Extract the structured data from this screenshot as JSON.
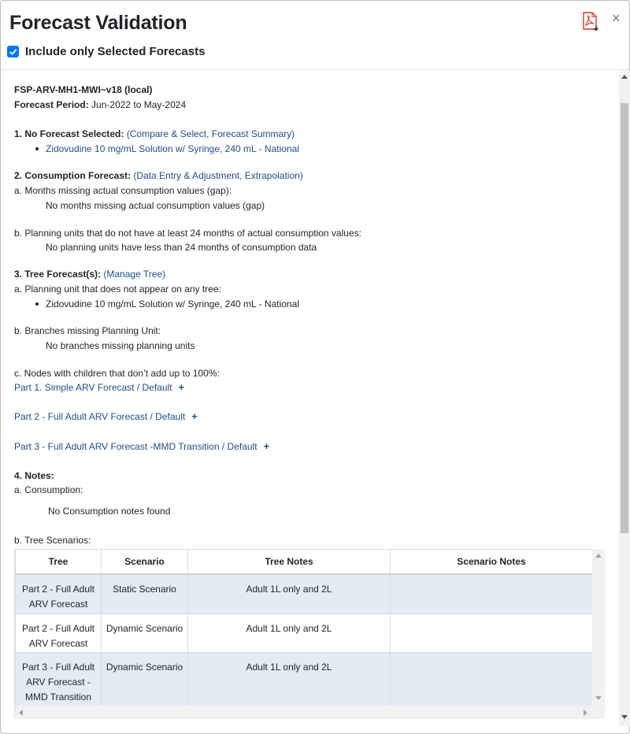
{
  "modal": {
    "title": "Forecast Validation",
    "include_label": "Include only Selected Forecasts",
    "include_checked": true,
    "icons": {
      "export": "pdf-export-icon",
      "close": "close-icon"
    },
    "close_glyph": "×"
  },
  "content": {
    "program": "FSP-ARV-MH1-MWI~v18 (local)",
    "period_label": "Forecast Period:",
    "period_value": "Jun-2022 to May-2024",
    "s1": {
      "heading": "1. No Forecast Selected:",
      "open": "(",
      "links": [
        "Compare & Select",
        "Forecast Summary"
      ],
      "sep": ", ",
      "close": ")",
      "items": [
        "Zidovudine 10 mg/mL Solution w/ Syringe, 240 mL - National"
      ]
    },
    "s2": {
      "heading": "2. Consumption Forecast:",
      "open": "(",
      "links": [
        "Data Entry & Adjustment",
        "Extrapolation"
      ],
      "sep": ", ",
      "close": ")",
      "a_label": "a. Months missing actual consumption values (gap):",
      "a_value": "No months missing actual consumption values (gap)",
      "b_label": "b. Planning units that do not have at least 24 months of actual consumption values:",
      "b_value": "No planning units have less than 24 months of consumption data"
    },
    "s3": {
      "heading": "3. Tree Forecast(s):",
      "open": "(",
      "link": "Manage Tree",
      "close": ")",
      "a_label": "a. Planning unit that does not appear on any tree:",
      "a_items": [
        "Zidovudine 10 mg/mL Solution w/ Syringe, 240 mL - National"
      ],
      "b_label": "b. Branches missing Planning Unit:",
      "b_value": "No branches missing planning units",
      "c_label": "c. Nodes with children that don’t add up to 100%:",
      "trees": [
        "Part 1. Simple ARV Forecast / Default",
        "Part 2 - Full Adult ARV Forecast / Default",
        "Part 3 - Full Adult ARV Forecast -MMD Transition / Default"
      ],
      "expand_glyph": "+"
    },
    "s4": {
      "heading": "4. Notes:",
      "a_label": "a. Consumption:",
      "a_value": "No Consumption notes found",
      "b_label": "b. Tree Scenarios:"
    },
    "table": {
      "headers": [
        "Tree",
        "Scenario",
        "Tree Notes",
        "Scenario Notes"
      ],
      "rows": [
        {
          "tree": [
            "Part 2 - Full Adult",
            "ARV Forecast"
          ],
          "scenario": "Static Scenario",
          "tree_notes": "Adult 1L only and 2L",
          "scenario_notes": ""
        },
        {
          "tree": [
            "Part 2 - Full Adult",
            "ARV Forecast"
          ],
          "scenario": "Dynamic Scenario",
          "tree_notes": "Adult 1L only and 2L",
          "scenario_notes": ""
        },
        {
          "tree": [
            "Part 3 - Full Adult",
            "ARV Forecast -",
            "MMD Transition"
          ],
          "scenario": "Dynamic Scenario",
          "tree_notes": "Adult 1L only and 2L",
          "scenario_notes": ""
        }
      ]
    }
  },
  "colors": {
    "link": "#1f4e8c",
    "checkbox": "#0075ff",
    "row_shade": "#e3ebf5",
    "pdf_red": "#d9342b"
  }
}
